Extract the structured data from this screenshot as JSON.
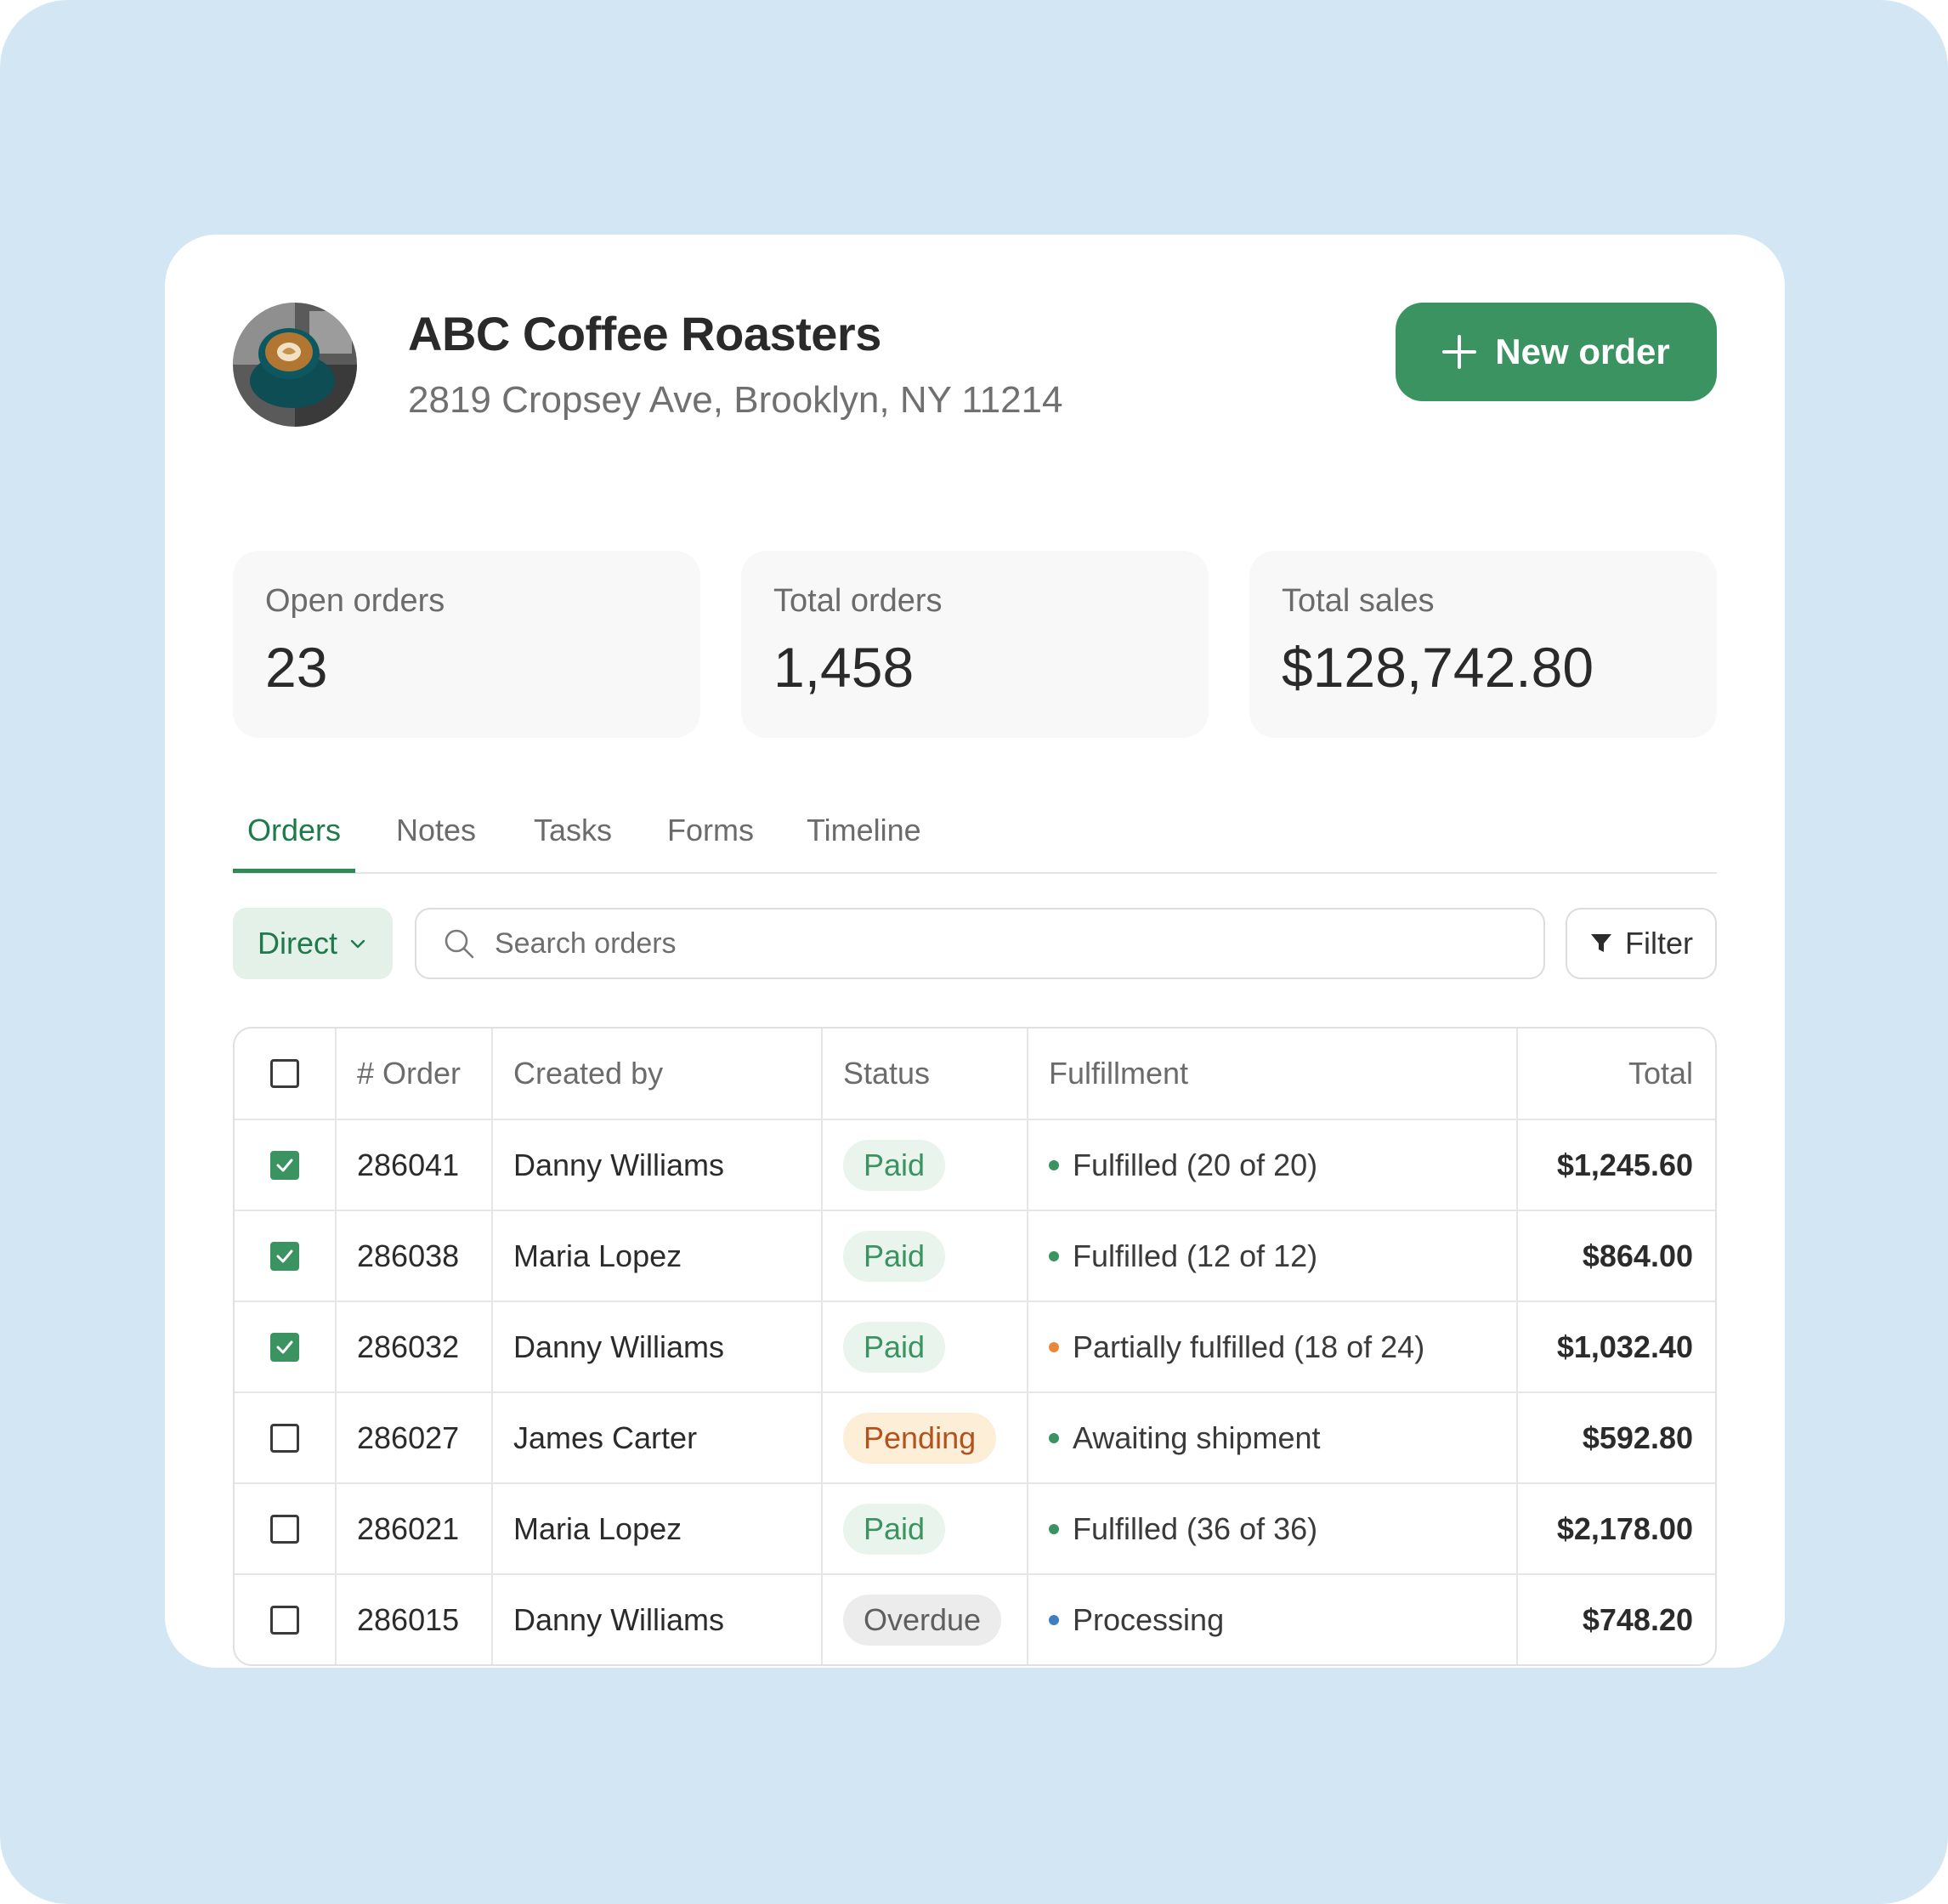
{
  "company": {
    "name": "ABC Coffee Roasters",
    "address": "2819 Cropsey Ave, Brooklyn, NY 11214",
    "avatar_icon": "coffee-cup-photo"
  },
  "actions": {
    "new_order_label": "New order"
  },
  "stats": [
    {
      "label": "Open orders",
      "value": "23"
    },
    {
      "label": "Total orders",
      "value": "1,458"
    },
    {
      "label": "Total sales",
      "value": "$128,742.80"
    }
  ],
  "tabs": [
    {
      "label": "Orders",
      "active": true
    },
    {
      "label": "Notes",
      "active": false
    },
    {
      "label": "Tasks",
      "active": false
    },
    {
      "label": "Forms",
      "active": false
    },
    {
      "label": "Timeline",
      "active": false
    }
  ],
  "toolbar": {
    "channel_selected": "Direct",
    "search_placeholder": "Search orders",
    "filter_label": "Filter"
  },
  "table": {
    "headers": {
      "order": "# Order",
      "created_by": "Created by",
      "status": "Status",
      "fulfillment": "Fulfillment",
      "total": "Total"
    },
    "rows": [
      {
        "checked": true,
        "order": "286041",
        "created_by": "Danny Williams",
        "status": "Paid",
        "fulfillment": "Fulfilled (20 of 20)",
        "total": "$1,245.60"
      },
      {
        "checked": true,
        "order": "286038",
        "created_by": "Maria Lopez",
        "status": "Paid",
        "fulfillment": "Fulfilled (12 of 12)",
        "total": "$864.00"
      },
      {
        "checked": true,
        "order": "286032",
        "created_by": "Danny Williams",
        "status": "Paid",
        "fulfillment": "Partially fulfilled (18 of 24)",
        "total": "$1,032.40"
      },
      {
        "checked": false,
        "order": "286027",
        "created_by": "James Carter",
        "status": "Pending",
        "fulfillment": "Awaiting shipment",
        "total": "$592.80"
      },
      {
        "checked": false,
        "order": "286021",
        "created_by": "Maria Lopez",
        "status": "Paid",
        "fulfillment": "Fulfilled (36 of 36)",
        "total": "$2,178.00"
      },
      {
        "checked": false,
        "order": "286015",
        "created_by": "Danny Williams",
        "status": "Overdue",
        "fulfillment": "Processing",
        "total": "$748.20"
      }
    ]
  },
  "colors": {
    "accent": "#3b9361",
    "page_background": "#d2e6f4",
    "status": {
      "Paid": {
        "bg": "#e8f4ec",
        "fg": "#3b9361"
      },
      "Pending": {
        "bg": "#fdeed8",
        "fg": "#b4521d"
      },
      "Overdue": {
        "bg": "#ececec",
        "fg": "#5f5f5f"
      }
    },
    "fulfillment_dot": {
      "Fulfilled (20 of 20)": "#3b9361",
      "Fulfilled (12 of 12)": "#3b9361",
      "Partially fulfilled (18 of 24)": "#e8883a",
      "Awaiting shipment": "#3b9361",
      "Fulfilled (36 of 36)": "#3b9361",
      "Processing": "#3e7fc1"
    }
  }
}
